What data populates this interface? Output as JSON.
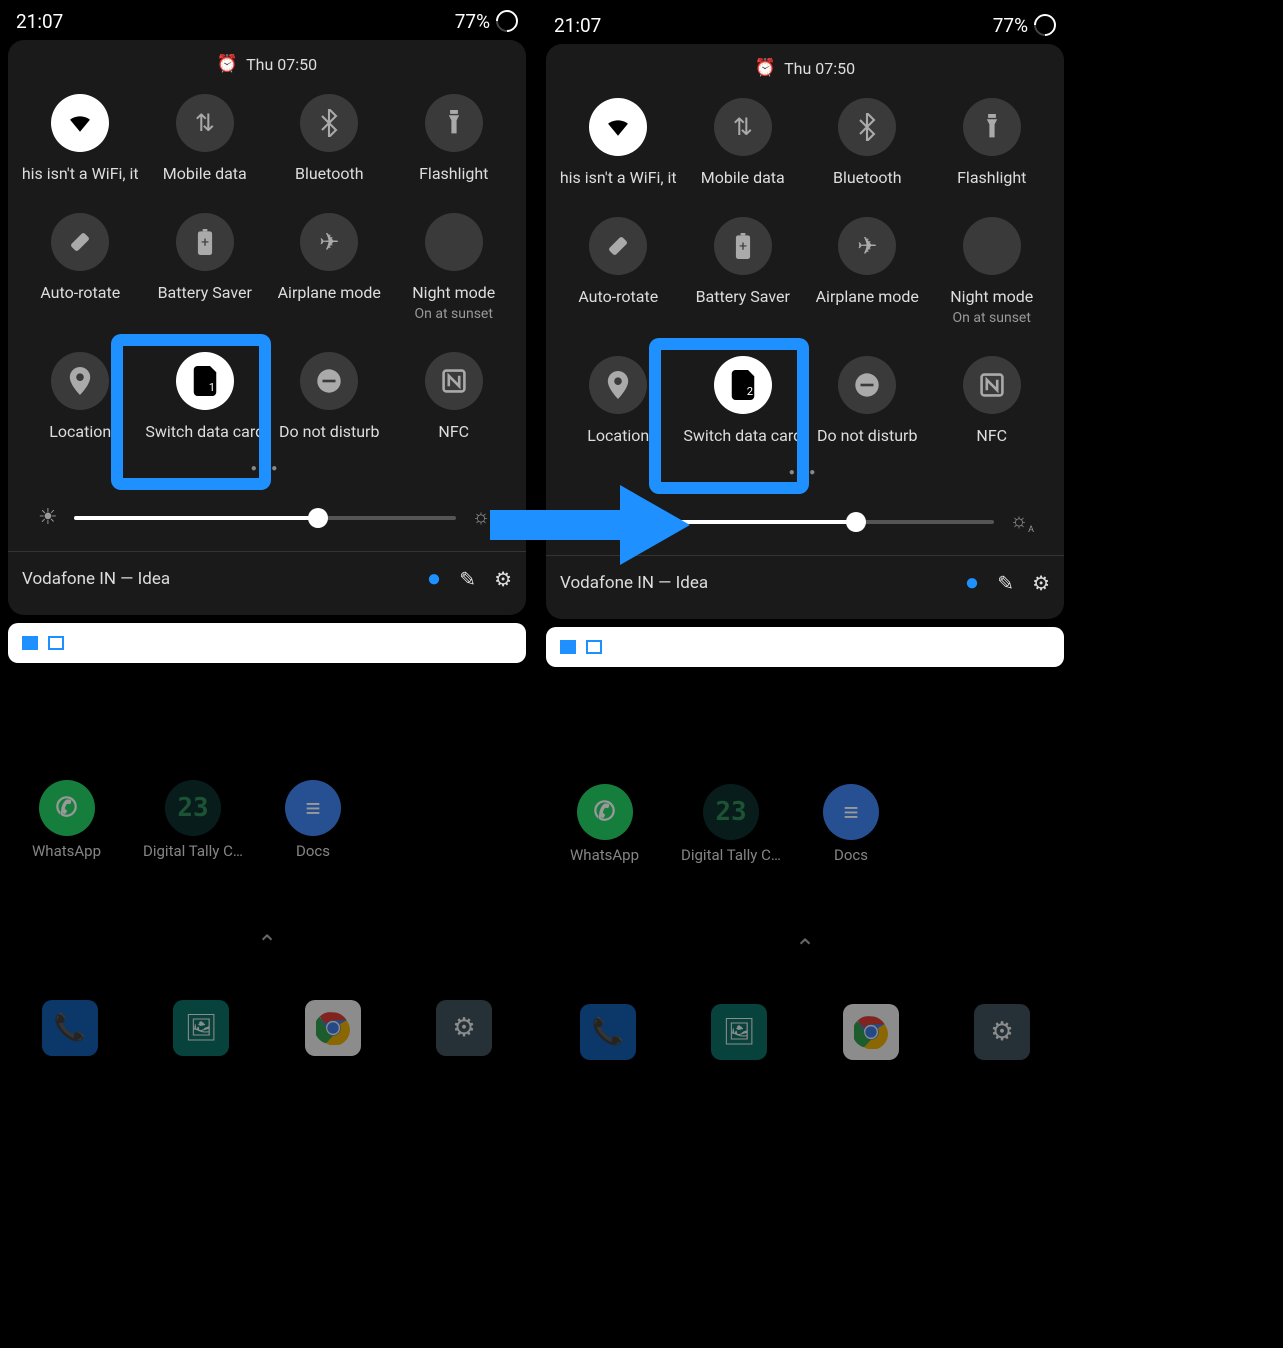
{
  "status": {
    "time": "21:07",
    "battery": "77%"
  },
  "header": {
    "date": "Thu 07:50"
  },
  "tiles": [
    {
      "label": "his isn't a WiFi, it",
      "icon": "wifi",
      "active": true
    },
    {
      "label": "Mobile data",
      "icon": "mobile-data"
    },
    {
      "label": "Bluetooth",
      "icon": "bluetooth"
    },
    {
      "label": "Flashlight",
      "icon": "flashlight"
    },
    {
      "label": "Auto-rotate",
      "icon": "auto-rotate"
    },
    {
      "label": "Battery Saver",
      "icon": "battery-saver"
    },
    {
      "label": "Airplane mode",
      "icon": "airplane"
    },
    {
      "label": "Night mode",
      "icon": "night-mode",
      "sub": "On at sunset"
    },
    {
      "label": "Location",
      "icon": "location"
    },
    {
      "label": "Switch data card",
      "icon": "sim",
      "active": true,
      "highlight": true,
      "sim_left": "1",
      "sim_right": "2"
    },
    {
      "label": "Do not disturb",
      "icon": "dnd"
    },
    {
      "label": "NFC",
      "icon": "nfc"
    }
  ],
  "footer": {
    "carrier": "Vodafone IN — Idea"
  },
  "apps": [
    {
      "label": "WhatsApp",
      "color": "#25D366"
    },
    {
      "label": "Digital Tally Co…",
      "color": "#0e2f2f",
      "text": "23"
    },
    {
      "label": "Docs",
      "color": "#4285f4"
    }
  ]
}
